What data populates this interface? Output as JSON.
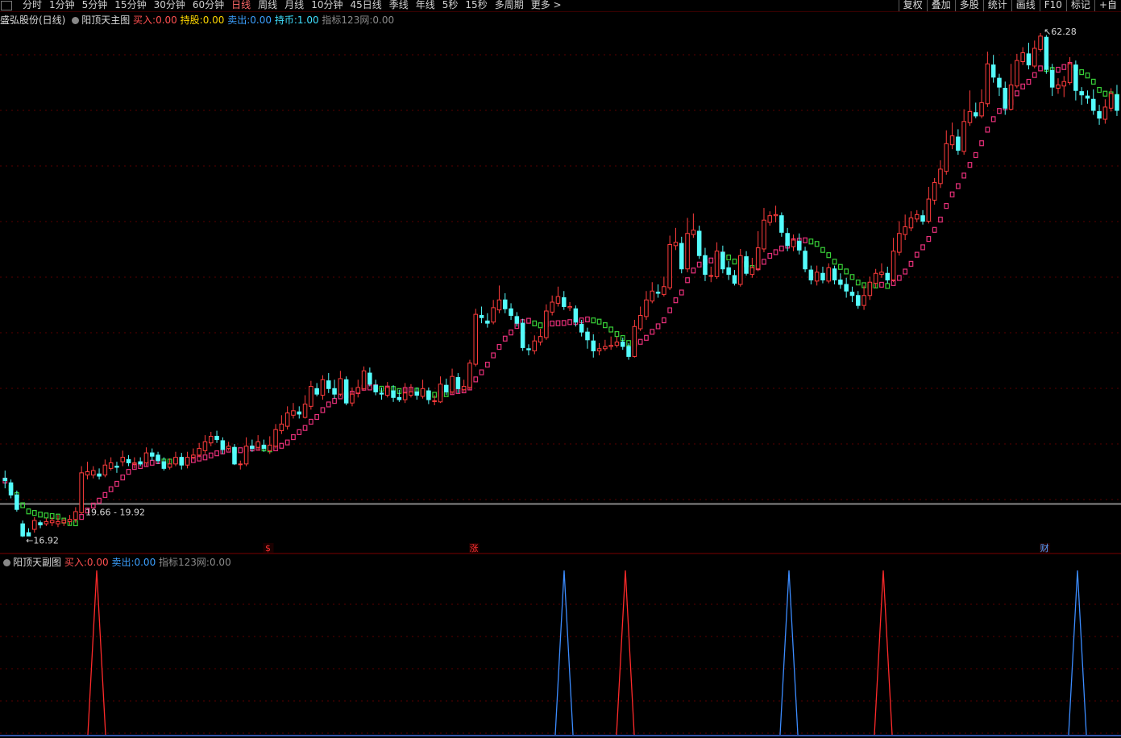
{
  "toolbar": {
    "periods": [
      "分时",
      "1分钟",
      "5分钟",
      "15分钟",
      "30分钟",
      "60分钟",
      "日线",
      "周线",
      "月线",
      "10分钟",
      "45日线",
      "季线",
      "年线",
      "5秒",
      "15秒",
      "多周期",
      "更多 >"
    ],
    "active_period": "日线",
    "right_tools": [
      "复权",
      "叠加",
      "多股",
      "统计",
      "画线",
      "F10",
      "标记",
      "+自"
    ]
  },
  "main_panel": {
    "stock_name": "盛弘股份(日线)",
    "indicator_name": "阳顶天主图",
    "buy_label": "买入:",
    "buy_value": "0.00",
    "hold_label": "持股:",
    "hold_value": "0.00",
    "sell_label": "卖出:",
    "sell_value": "0.00",
    "coin_label": "持币:",
    "coin_value": "1.00",
    "net_label": "指标123网:",
    "net_value": "0.00",
    "high_label": "62.28",
    "low_label": "16.92",
    "range_label": "19.66 - 19.92",
    "markers": [
      "$",
      "涨",
      "财"
    ]
  },
  "sub_panel": {
    "indicator_name": "阳顶天副图",
    "buy_label": "买入:",
    "buy_value": "0.00",
    "sell_label": "卖出:",
    "sell_value": "0.00",
    "net_label": "指标123网:",
    "net_value": "0.00"
  },
  "chart_data": {
    "type": "candlestick",
    "title": "盛弘股份(日线)",
    "price_range": [
      16.92,
      62.28
    ],
    "price_lines": {
      "high": 62.28,
      "low": 16.92,
      "band": [
        19.66,
        19.92
      ]
    },
    "colors": {
      "up": "#ff3c3c",
      "down": "#54fcfc",
      "line_up": "#e8307a",
      "line_down": "#38d038",
      "grid": "#5a0000",
      "buy_spike": "#ff2a2a",
      "sell_spike": "#3c8cff"
    },
    "candles": [
      [
        22.1,
        21.9,
        22.8,
        21.2
      ],
      [
        21.7,
        20.6,
        22.0,
        20.3
      ],
      [
        20.6,
        19.3,
        21.0,
        19.1
      ],
      [
        18.0,
        16.9,
        18.3,
        16.8
      ],
      [
        17.2,
        16.9,
        17.6,
        16.92
      ],
      [
        17.5,
        18.3,
        18.6,
        17.2
      ],
      [
        18.1,
        17.9,
        18.3,
        17.6
      ],
      [
        18.0,
        18.2,
        18.5,
        17.8
      ],
      [
        18.1,
        18.3,
        18.6,
        17.8
      ],
      [
        18.0,
        18.2,
        18.8,
        17.7
      ],
      [
        18.1,
        18.3,
        18.5,
        17.8
      ],
      [
        18.2,
        18.4,
        18.8,
        17.9
      ],
      [
        18.4,
        19.1,
        19.5,
        18.1
      ],
      [
        19.0,
        22.6,
        23.2,
        18.9
      ],
      [
        22.4,
        22.7,
        23.6,
        22.0
      ],
      [
        22.4,
        22.8,
        23.2,
        22.1
      ],
      [
        22.5,
        22.3,
        23.0,
        22.0
      ],
      [
        22.4,
        23.3,
        23.8,
        22.2
      ],
      [
        23.0,
        23.5,
        24.0,
        22.8
      ],
      [
        23.2,
        23.1,
        23.6,
        22.6
      ],
      [
        23.6,
        24.0,
        24.6,
        23.2
      ],
      [
        23.8,
        23.5,
        24.2,
        23.2
      ],
      [
        23.4,
        23.5,
        24.0,
        23.0
      ],
      [
        23.6,
        23.4,
        24.0,
        23.2
      ],
      [
        23.5,
        24.4,
        24.9,
        23.2
      ],
      [
        24.4,
        24.1,
        24.8,
        23.7
      ],
      [
        24.2,
        23.7,
        24.5,
        23.4
      ],
      [
        23.6,
        23.0,
        24.0,
        22.8
      ],
      [
        23.1,
        23.4,
        23.9,
        22.9
      ],
      [
        23.4,
        24.0,
        24.5,
        23.2
      ],
      [
        24.0,
        23.3,
        24.4,
        22.9
      ],
      [
        23.3,
        24.0,
        24.5,
        23.0
      ],
      [
        24.0,
        24.2,
        24.8,
        23.8
      ],
      [
        24.2,
        24.8,
        25.3,
        24.0
      ],
      [
        24.6,
        25.4,
        26.0,
        24.3
      ],
      [
        25.3,
        25.9,
        26.3,
        25.0
      ],
      [
        25.9,
        25.6,
        26.4,
        25.3
      ],
      [
        25.5,
        24.7,
        25.8,
        24.3
      ],
      [
        24.8,
        25.0,
        25.4,
        24.6
      ],
      [
        24.9,
        23.4,
        25.2,
        23.3
      ],
      [
        23.4,
        23.4,
        23.7,
        22.9
      ],
      [
        23.4,
        25.0,
        25.8,
        23.2
      ],
      [
        25.0,
        24.8,
        25.6,
        24.5
      ],
      [
        24.9,
        25.4,
        26.0,
        24.6
      ],
      [
        25.1,
        24.8,
        25.6,
        24.5
      ],
      [
        24.6,
        25.1,
        25.9,
        24.3
      ],
      [
        25.0,
        26.5,
        27.0,
        24.8
      ],
      [
        26.4,
        27.0,
        27.8,
        26.1
      ],
      [
        26.8,
        28.0,
        28.6,
        26.5
      ],
      [
        27.8,
        28.2,
        28.9,
        27.5
      ],
      [
        28.1,
        27.9,
        28.6,
        27.5
      ],
      [
        27.6,
        28.8,
        29.6,
        27.5
      ],
      [
        28.6,
        30.4,
        30.9,
        28.3
      ],
      [
        30.2,
        29.7,
        30.7,
        29.5
      ],
      [
        29.6,
        31.0,
        31.4,
        29.2
      ],
      [
        30.9,
        30.2,
        31.6,
        29.8
      ],
      [
        30.2,
        29.7,
        31.0,
        29.3
      ],
      [
        29.7,
        31.1,
        31.8,
        29.5
      ],
      [
        31.0,
        28.9,
        31.3,
        28.7
      ],
      [
        28.9,
        29.7,
        30.3,
        28.6
      ],
      [
        29.8,
        30.3,
        31.0,
        29.4
      ],
      [
        30.2,
        31.8,
        32.2,
        30.0
      ],
      [
        31.6,
        30.6,
        32.1,
        30.4
      ],
      [
        30.5,
        29.9,
        31.0,
        29.6
      ],
      [
        29.8,
        29.7,
        30.3,
        29.2
      ],
      [
        29.6,
        30.3,
        30.8,
        29.4
      ],
      [
        30.0,
        29.4,
        30.5,
        29.0
      ],
      [
        29.4,
        29.2,
        30.1,
        29.0
      ],
      [
        29.2,
        29.8,
        30.7,
        28.9
      ],
      [
        29.6,
        29.9,
        30.6,
        29.4
      ],
      [
        29.9,
        29.6,
        30.3,
        29.2
      ],
      [
        29.5,
        30.2,
        31.0,
        29.3
      ],
      [
        30.0,
        29.2,
        30.3,
        28.8
      ],
      [
        29.1,
        29.1,
        29.6,
        28.7
      ],
      [
        29.0,
        30.6,
        31.3,
        28.9
      ],
      [
        30.5,
        29.9,
        31.1,
        29.6
      ],
      [
        29.9,
        31.3,
        32.0,
        29.7
      ],
      [
        31.2,
        30.2,
        31.6,
        29.8
      ],
      [
        30.1,
        30.4,
        31.0,
        29.9
      ],
      [
        30.3,
        32.5,
        32.8,
        30.1
      ],
      [
        32.4,
        36.9,
        37.4,
        32.2
      ],
      [
        36.8,
        36.6,
        37.6,
        36.1
      ],
      [
        36.3,
        36.1,
        37.0,
        35.7
      ],
      [
        36.2,
        37.5,
        38.2,
        36.0
      ],
      [
        37.3,
        38.2,
        39.5,
        37.0
      ],
      [
        38.2,
        37.4,
        38.8,
        37.0
      ],
      [
        37.4,
        36.8,
        37.9,
        36.4
      ],
      [
        36.7,
        36.1,
        37.1,
        35.8
      ],
      [
        36.1,
        33.9,
        36.5,
        33.6
      ],
      [
        33.8,
        33.7,
        34.2,
        33.2
      ],
      [
        33.6,
        34.5,
        35.0,
        33.3
      ],
      [
        34.4,
        34.9,
        35.6,
        34.1
      ],
      [
        34.8,
        37.2,
        37.8,
        34.6
      ],
      [
        37.1,
        38.0,
        38.6,
        36.8
      ],
      [
        37.9,
        38.5,
        39.4,
        37.6
      ],
      [
        38.4,
        37.6,
        39.0,
        37.3
      ],
      [
        37.5,
        37.6,
        38.0,
        37.2
      ],
      [
        37.4,
        36.2,
        37.7,
        35.8
      ],
      [
        36.0,
        35.3,
        36.4,
        34.9
      ],
      [
        35.3,
        34.6,
        35.7,
        33.8
      ],
      [
        34.5,
        33.6,
        35.1,
        33.0
      ],
      [
        33.6,
        33.8,
        34.3,
        33.2
      ],
      [
        33.8,
        34.0,
        34.6,
        33.6
      ],
      [
        34.0,
        34.1,
        34.9,
        33.7
      ],
      [
        34.1,
        34.4,
        34.9,
        33.9
      ],
      [
        34.4,
        34.0,
        34.8,
        33.7
      ],
      [
        34.0,
        33.1,
        34.3,
        32.8
      ],
      [
        33.1,
        35.8,
        36.4,
        33.0
      ],
      [
        35.6,
        36.8,
        37.6,
        35.4
      ],
      [
        36.7,
        38.2,
        39.0,
        36.4
      ],
      [
        38.1,
        39.0,
        39.8,
        37.9
      ],
      [
        38.9,
        38.8,
        39.6,
        38.4
      ],
      [
        38.7,
        39.4,
        40.3,
        38.5
      ],
      [
        39.3,
        43.2,
        44.0,
        39.1
      ],
      [
        43.1,
        43.4,
        44.7,
        42.7
      ],
      [
        43.3,
        41.0,
        43.9,
        40.6
      ],
      [
        41.0,
        44.2,
        45.6,
        40.7
      ],
      [
        44.1,
        44.5,
        46.0,
        43.8
      ],
      [
        44.4,
        42.2,
        44.9,
        41.9
      ],
      [
        42.2,
        40.5,
        42.9,
        39.9
      ],
      [
        40.4,
        40.4,
        41.2,
        39.8
      ],
      [
        40.3,
        42.6,
        43.4,
        40.1
      ],
      [
        42.5,
        41.0,
        43.1,
        40.6
      ],
      [
        41.1,
        40.5,
        41.7,
        40.0
      ],
      [
        40.4,
        39.7,
        40.9,
        39.5
      ],
      [
        39.6,
        42.2,
        42.8,
        39.4
      ],
      [
        42.1,
        40.6,
        42.6,
        40.4
      ],
      [
        40.5,
        41.1,
        42.0,
        40.2
      ],
      [
        41.0,
        42.9,
        44.4,
        40.8
      ],
      [
        42.8,
        45.4,
        46.5,
        42.5
      ],
      [
        45.2,
        45.8,
        46.2,
        44.9
      ],
      [
        45.8,
        45.9,
        46.7,
        45.2
      ],
      [
        45.8,
        44.3,
        46.1,
        43.9
      ],
      [
        44.2,
        43.1,
        44.7,
        42.6
      ],
      [
        43.0,
        43.6,
        44.1,
        42.6
      ],
      [
        43.5,
        42.7,
        44.2,
        42.3
      ],
      [
        42.6,
        41.0,
        43.0,
        40.7
      ],
      [
        40.9,
        40.0,
        41.3,
        39.6
      ],
      [
        39.9,
        40.7,
        41.3,
        39.5
      ],
      [
        40.6,
        40.0,
        41.2,
        39.7
      ],
      [
        39.9,
        41.1,
        41.5,
        39.7
      ],
      [
        41.0,
        40.0,
        41.3,
        39.6
      ],
      [
        40.0,
        39.6,
        40.6,
        39.2
      ],
      [
        39.6,
        39.0,
        40.2,
        38.4
      ],
      [
        38.9,
        38.6,
        39.4,
        38.0
      ],
      [
        38.6,
        37.7,
        39.0,
        37.4
      ],
      [
        37.7,
        38.6,
        39.5,
        37.3
      ],
      [
        38.6,
        39.8,
        40.3,
        38.2
      ],
      [
        39.7,
        40.6,
        41.0,
        39.3
      ],
      [
        40.5,
        40.7,
        41.5,
        40.2
      ],
      [
        40.6,
        40.0,
        41.2,
        39.7
      ],
      [
        40.0,
        42.6,
        43.8,
        39.8
      ],
      [
        42.5,
        44.2,
        45.3,
        42.2
      ],
      [
        44.1,
        44.8,
        45.9,
        43.6
      ],
      [
        44.7,
        45.6,
        46.2,
        44.4
      ],
      [
        45.5,
        45.9,
        46.3,
        45.2
      ],
      [
        45.8,
        45.3,
        46.3,
        45.0
      ],
      [
        45.3,
        47.3,
        48.4,
        45.1
      ],
      [
        47.2,
        48.8,
        49.2,
        46.8
      ],
      [
        48.7,
        50.0,
        50.8,
        48.3
      ],
      [
        49.8,
        52.3,
        53.5,
        49.5
      ],
      [
        52.2,
        53.0,
        54.2,
        51.8
      ],
      [
        52.9,
        51.7,
        53.6,
        51.3
      ],
      [
        51.6,
        54.3,
        55.4,
        51.3
      ],
      [
        54.2,
        55.2,
        57.1,
        53.9
      ],
      [
        55.1,
        54.8,
        56.0,
        54.6
      ],
      [
        54.8,
        56.0,
        57.2,
        54.6
      ],
      [
        55.9,
        59.5,
        60.6,
        55.6
      ],
      [
        59.4,
        58.3,
        60.3,
        57.8
      ],
      [
        58.2,
        57.4,
        58.6,
        56.6
      ],
      [
        57.3,
        55.5,
        57.9,
        54.9
      ],
      [
        55.4,
        57.6,
        59.5,
        55.3
      ],
      [
        57.5,
        59.8,
        60.4,
        57.3
      ],
      [
        59.7,
        60.5,
        61.0,
        59.4
      ],
      [
        60.4,
        59.4,
        61.4,
        59.0
      ],
      [
        59.3,
        60.9,
        61.6,
        59.1
      ],
      [
        60.8,
        62.0,
        62.28,
        60.6
      ],
      [
        61.9,
        59.0,
        62.1,
        58.6
      ],
      [
        58.9,
        57.4,
        59.5,
        56.6
      ],
      [
        57.3,
        57.6,
        58.2,
        56.8
      ],
      [
        57.5,
        57.9,
        58.4,
        56.5
      ],
      [
        57.8,
        59.5,
        60.1,
        57.6
      ],
      [
        59.4,
        57.1,
        59.8,
        56.2
      ],
      [
        57.0,
        56.7,
        57.4,
        55.8
      ],
      [
        56.6,
        56.4,
        57.1,
        55.9
      ],
      [
        56.3,
        55.3,
        57.2,
        54.9
      ],
      [
        55.2,
        54.6,
        55.8,
        54.0
      ],
      [
        54.5,
        55.6,
        56.3,
        54.1
      ],
      [
        55.5,
        56.8,
        57.3,
        55.2
      ],
      [
        56.7,
        55.3,
        57.6,
        54.8
      ]
    ]
  }
}
